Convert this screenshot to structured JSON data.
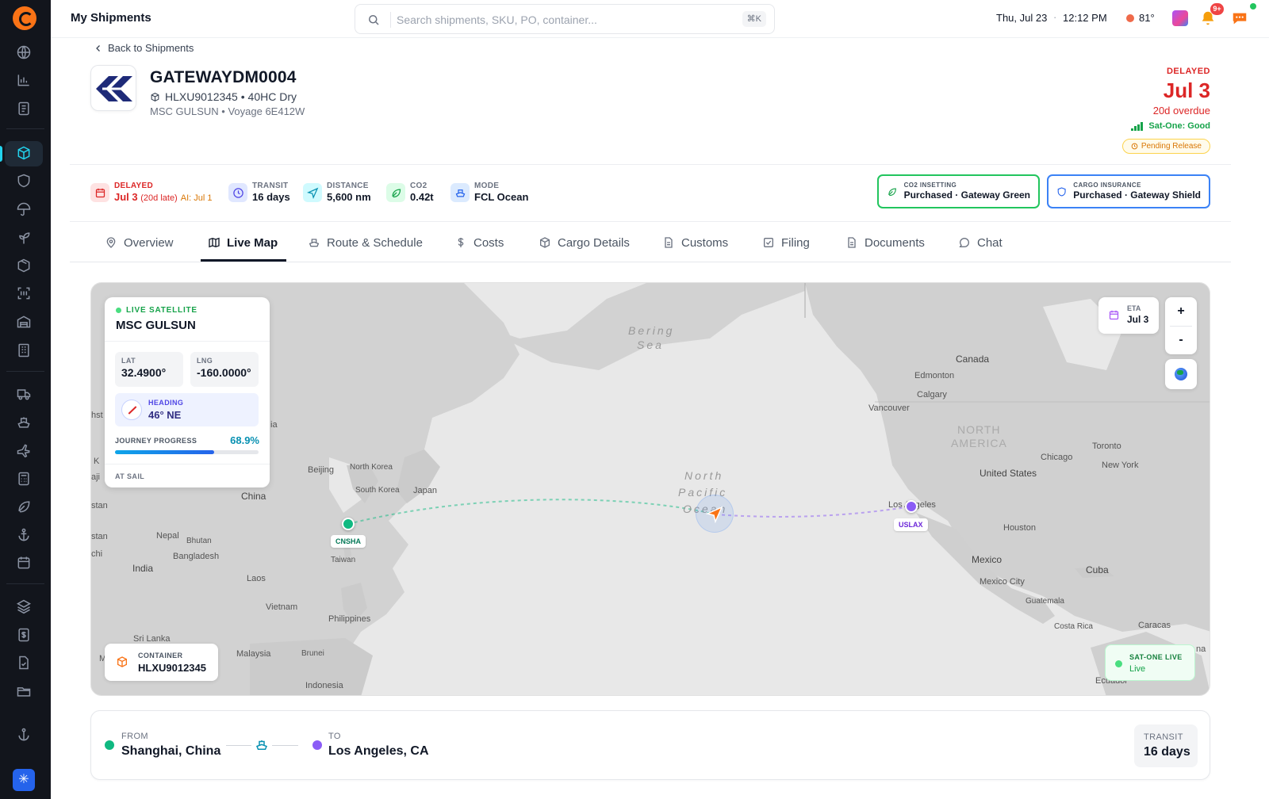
{
  "app": {
    "title": "My Shipments"
  },
  "search": {
    "placeholder": "Search shipments, SKU, PO, container...",
    "shortcut": "⌘K"
  },
  "topbar": {
    "date": "Thu, Jul 23",
    "separator": "·",
    "time": "12:12 PM",
    "temperature": "81°",
    "notification_badge": "9+"
  },
  "back_link": "Back to Shipments",
  "shipment": {
    "id": "GATEWAYDM0004",
    "container_line": "HLXU9012345 • 40HC Dry",
    "vessel_line": "MSC GULSUN • Voyage 6E412W"
  },
  "status": {
    "label": "DELAYED",
    "date": "Jul 3",
    "overdue": "20d overdue",
    "sat_status": "Sat-One: Good",
    "pill": "Pending Release"
  },
  "metrics": [
    {
      "label": "DELAYED",
      "value": "Jul 3",
      "late": "(20d late)",
      "ai": "AI: Jul 1"
    },
    {
      "label": "TRANSIT",
      "value": "16 days"
    },
    {
      "label": "DISTANCE",
      "value": "5,600 nm"
    },
    {
      "label": "CO2",
      "value": "0.42t"
    },
    {
      "label": "MODE",
      "value": "FCL Ocean"
    }
  ],
  "insurance": [
    {
      "label": "CO2 INSETTING",
      "value": "Purchased · Gateway Green"
    },
    {
      "label": "CARGO INSURANCE",
      "value": "Purchased · Gateway Shield"
    }
  ],
  "tabs": [
    {
      "label": "Overview"
    },
    {
      "label": "Live Map"
    },
    {
      "label": "Route & Schedule"
    },
    {
      "label": "Costs"
    },
    {
      "label": "Cargo Details"
    },
    {
      "label": "Customs"
    },
    {
      "label": "Filing"
    },
    {
      "label": "Documents"
    },
    {
      "label": "Chat"
    }
  ],
  "satellite": {
    "live_label": "LIVE SATELLITE",
    "vessel": "MSC GULSUN",
    "lat_label": "LAT",
    "lat": "32.4900°",
    "lng_label": "LNG",
    "lng": "-160.0000°",
    "heading_label": "HEADING",
    "heading": "46° NE",
    "progress_label": "JOURNEY PROGRESS",
    "progress_text": "68.9%",
    "progress": 0.689,
    "state": "AT SAIL"
  },
  "map": {
    "eta_label": "ETA",
    "eta": "Jul 3",
    "zoom_in": "+",
    "zoom_out": "-",
    "container_label": "CONTAINER",
    "container": "HLXU9012345",
    "live_label": "SAT-ONE LIVE",
    "live_value": "Live",
    "origin_code": "CNSHA",
    "dest_code": "USLAX",
    "labels": {
      "bering1": "Bering",
      "bering2": "Sea",
      "npac1": "North",
      "npac2": "Pacific",
      "npac3": "Ocean",
      "canada": "Canada",
      "edmonton": "Edmonton",
      "calgary": "Calgary",
      "vancouver": "Vancouver",
      "na1": "NORTH",
      "na2": "AMERICA",
      "toronto": "Toronto",
      "chicago": "Chicago",
      "newyork": "New York",
      "us": "United States",
      "losangeles": "Los Angeles",
      "houston": "Houston",
      "mexico": "Mexico",
      "mexicocity": "Mexico City",
      "cuba": "Cuba",
      "guatemala": "Guatemala",
      "costarica": "Costa Rica",
      "caracas": "Caracas",
      "ecuador": "Ecuador",
      "na_clip": "na",
      "beijing": "Beijing",
      "northkorea": "North Korea",
      "southkorea": "South Korea",
      "japan": "Japan",
      "china": "China",
      "nepal": "Nepal",
      "bhutan": "Bhutan",
      "bangladesh": "Bangladesh",
      "india": "India",
      "taiwan": "Taiwan",
      "laos": "Laos",
      "vietnam": "Vietnam",
      "philippines": "Philippines",
      "srilanka": "Sri Lanka",
      "malaysia": "Malaysia",
      "brunei": "Brunei",
      "indonesia": "Indonesia",
      "ia": "ia",
      "hst": "hst",
      "k": "K",
      "aji": "aji",
      "stan1": "stan",
      "stan2": "stan",
      "chi": "chi",
      "m": "M"
    }
  },
  "route": {
    "from_label": "FROM",
    "from": "Shanghai, China",
    "to_label": "TO",
    "to": "Los Angeles, CA",
    "transit_label": "TRANSIT",
    "transit": "16 days"
  },
  "colors": {
    "accent": "#22d3ee",
    "delayed": "#dc2626",
    "origin": "#10b981",
    "destination": "#8b5cf6"
  }
}
